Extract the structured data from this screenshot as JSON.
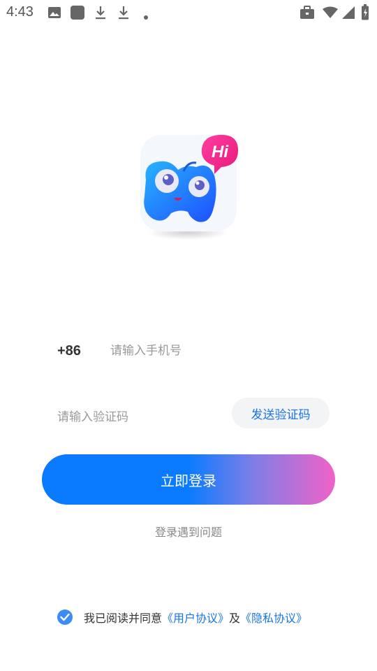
{
  "status_bar": {
    "time": "4:43",
    "icons": [
      "image-icon",
      "app-icon",
      "download-icon",
      "download-icon",
      "dot-icon",
      "briefcase-icon",
      "wifi-icon",
      "signal-icon",
      "battery-icon"
    ]
  },
  "logo": {
    "badge_text": "Hi",
    "brand_colors": [
      "#1a8cff",
      "#f02f8c"
    ]
  },
  "phone": {
    "prefix": "+86",
    "placeholder": "请输入手机号"
  },
  "code": {
    "placeholder": "请输入验证码",
    "send_label": "发送验证码"
  },
  "login": {
    "label": "立即登录"
  },
  "trouble": {
    "label": "登录遇到问题"
  },
  "agreement": {
    "checked": true,
    "prefix": "我已阅读并同意",
    "user_agreement": "《用户协议》",
    "conjunction": "及",
    "privacy_policy": "《隐私协议》"
  },
  "colors": {
    "accent": "#1a73e8",
    "gradient_start": "#0a7bff",
    "gradient_end": "#f062c8"
  }
}
